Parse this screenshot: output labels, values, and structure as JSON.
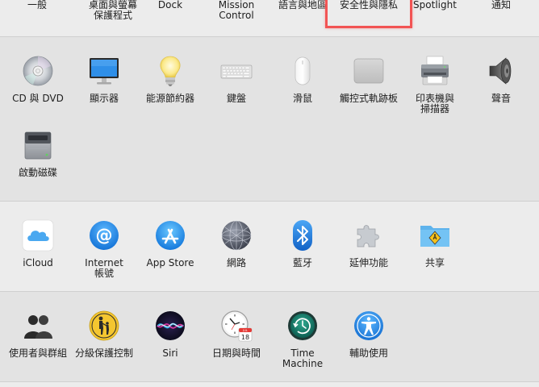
{
  "top_row": [
    {
      "label": "一般"
    },
    {
      "label": "桌面與螢幕\n保護程式"
    },
    {
      "label": "Dock"
    },
    {
      "label": "Mission\nControl"
    },
    {
      "label": "語言與地區"
    },
    {
      "label": "安全性與隱私"
    },
    {
      "label": "Spotlight"
    },
    {
      "label": "通知"
    }
  ],
  "hardware": [
    {
      "label": "CD 與 DVD",
      "icon": "cd-dvd-icon"
    },
    {
      "label": "顯示器",
      "icon": "display-icon"
    },
    {
      "label": "能源節約器",
      "icon": "energy-saver-icon"
    },
    {
      "label": "鍵盤",
      "icon": "keyboard-icon"
    },
    {
      "label": "滑鼠",
      "icon": "mouse-icon"
    },
    {
      "label": "觸控式軌跡板",
      "icon": "trackpad-icon"
    },
    {
      "label": "印表機與\n掃描器",
      "icon": "printer-icon"
    },
    {
      "label": "聲音",
      "icon": "speaker-icon"
    },
    {
      "label": "啟動磁碟",
      "icon": "startup-disk-icon"
    }
  ],
  "internet": [
    {
      "label": "iCloud",
      "icon": "icloud-icon"
    },
    {
      "label": "Internet\n帳號",
      "icon": "internet-accounts-icon"
    },
    {
      "label": "App Store",
      "icon": "app-store-icon"
    },
    {
      "label": "網路",
      "icon": "network-icon"
    },
    {
      "label": "藍牙",
      "icon": "bluetooth-icon"
    },
    {
      "label": "延伸功能",
      "icon": "extensions-icon"
    },
    {
      "label": "共享",
      "icon": "sharing-icon"
    }
  ],
  "system": [
    {
      "label": "使用者與群組",
      "icon": "users-groups-icon"
    },
    {
      "label": "分級保護控制",
      "icon": "parental-controls-icon"
    },
    {
      "label": "Siri",
      "icon": "siri-icon"
    },
    {
      "label": "日期與時間",
      "icon": "date-time-icon"
    },
    {
      "label": "Time Machine",
      "icon": "time-machine-icon"
    },
    {
      "label": "輔助使用",
      "icon": "accessibility-icon"
    }
  ],
  "calendar_icon": {
    "month": "JUL",
    "day": "18"
  },
  "colors": {
    "highlight": "#f25454",
    "section_alt": "#e3e3e3",
    "section": "#ececec",
    "accent_blue": "#1e88e5"
  }
}
